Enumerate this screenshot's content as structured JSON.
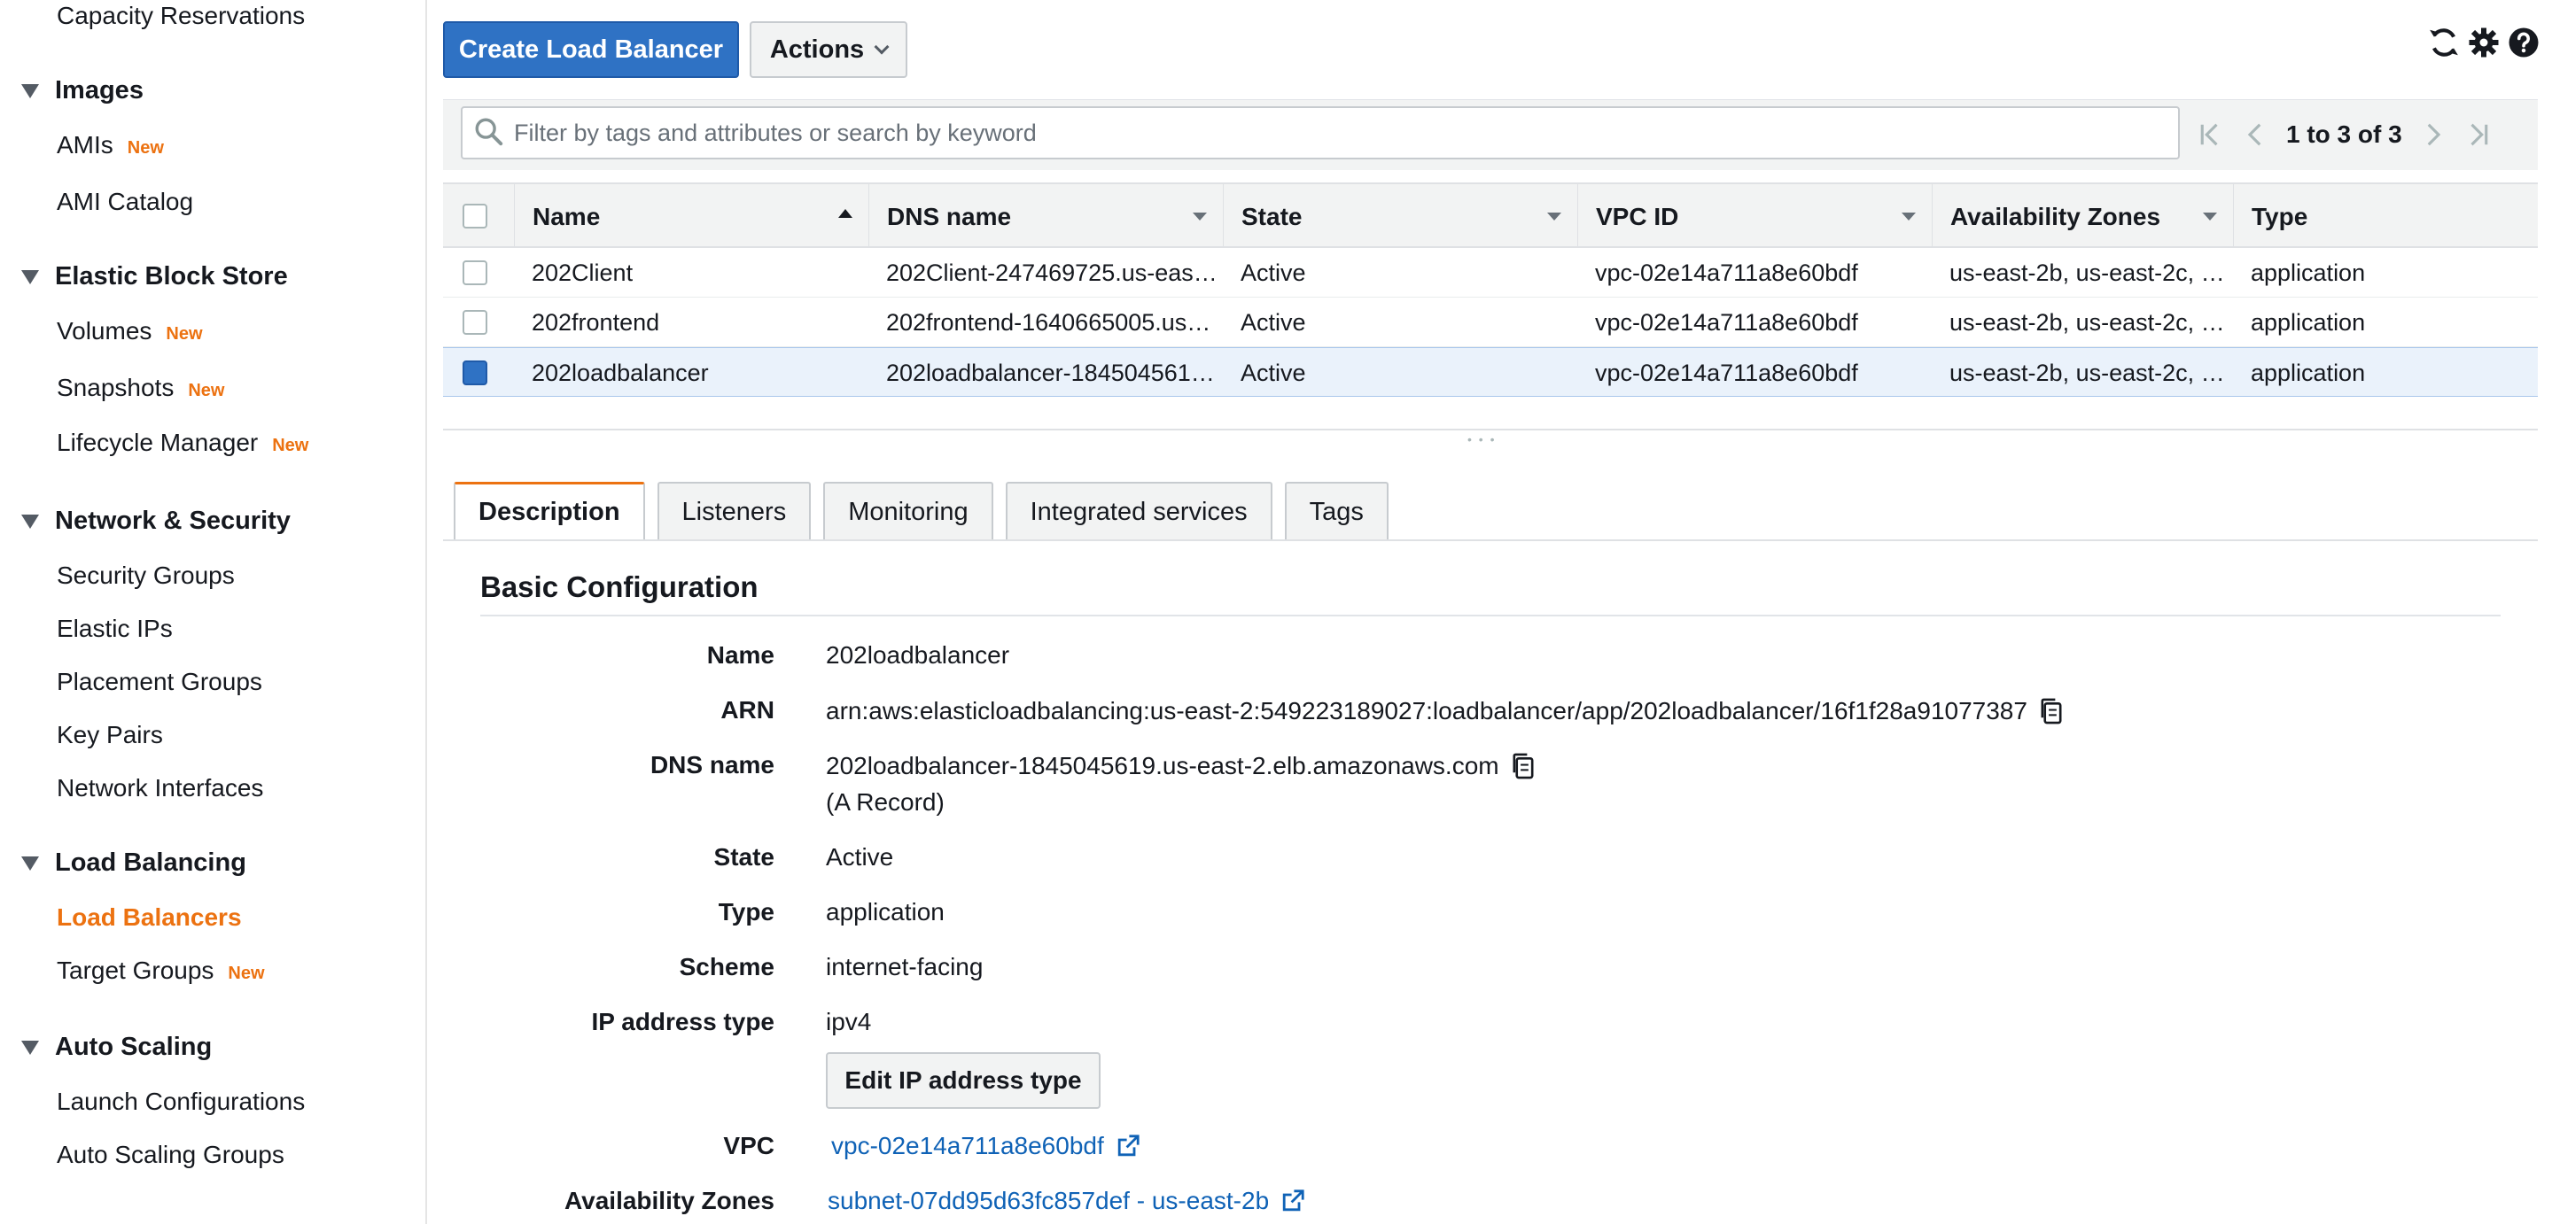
{
  "sidebar": {
    "capacity_reservations": "Capacity Reservations",
    "images": {
      "title": "Images",
      "amis": "AMIs",
      "amis_badge": "New",
      "ami_catalog": "AMI Catalog"
    },
    "ebs": {
      "title": "Elastic Block Store",
      "volumes": "Volumes",
      "volumes_badge": "New",
      "snapshots": "Snapshots",
      "snapshots_badge": "New",
      "lifecycle": "Lifecycle Manager",
      "lifecycle_badge": "New"
    },
    "network": {
      "title": "Network & Security",
      "security_groups": "Security Groups",
      "elastic_ips": "Elastic IPs",
      "placement_groups": "Placement Groups",
      "key_pairs": "Key Pairs",
      "network_interfaces": "Network Interfaces"
    },
    "load_balancing": {
      "title": "Load Balancing",
      "load_balancers": "Load Balancers",
      "target_groups": "Target Groups",
      "target_groups_badge": "New"
    },
    "auto_scaling": {
      "title": "Auto Scaling",
      "launch_configurations": "Launch Configurations",
      "auto_scaling_groups": "Auto Scaling Groups"
    }
  },
  "toolbar": {
    "create_label": "Create Load Balancer",
    "actions_label": "Actions"
  },
  "search": {
    "placeholder": "Filter by tags and attributes or search by keyword",
    "pager": "1 to 3 of 3"
  },
  "table": {
    "headers": {
      "name": "Name",
      "dns": "DNS name",
      "state": "State",
      "vpc": "VPC ID",
      "az": "Availability Zones",
      "type": "Type"
    },
    "rows": [
      {
        "name": "202Client",
        "dns": "202Client-247469725.us-eas…",
        "state": "Active",
        "vpc": "vpc-02e14a711a8e60bdf",
        "az": "us-east-2b, us-east-2c, …",
        "type": "application"
      },
      {
        "name": "202frontend",
        "dns": "202frontend-1640665005.us…",
        "state": "Active",
        "vpc": "vpc-02e14a711a8e60bdf",
        "az": "us-east-2b, us-east-2c, …",
        "type": "application"
      },
      {
        "name": "202loadbalancer",
        "dns": "202loadbalancer-184504561…",
        "state": "Active",
        "vpc": "vpc-02e14a711a8e60bdf",
        "az": "us-east-2b, us-east-2c, …",
        "type": "application"
      }
    ]
  },
  "tabs": {
    "description": "Description",
    "listeners": "Listeners",
    "monitoring": "Monitoring",
    "integrated": "Integrated services",
    "tags": "Tags"
  },
  "details": {
    "section_title": "Basic Configuration",
    "name_label": "Name",
    "name_value": "202loadbalancer",
    "arn_label": "ARN",
    "arn_value": "arn:aws:elasticloadbalancing:us-east-2:549223189027:loadbalancer/app/202loadbalancer/16f1f28a91077387",
    "dns_label": "DNS name",
    "dns_value": "202loadbalancer-1845045619.us-east-2.elb.amazonaws.com",
    "dns_note": "(A Record)",
    "state_label": "State",
    "state_value": "Active",
    "type_label": "Type",
    "type_value": "application",
    "scheme_label": "Scheme",
    "scheme_value": "internet-facing",
    "ip_label": "IP address type",
    "ip_value": "ipv4",
    "edit_ip_label": "Edit IP address type",
    "vpc_label": "VPC",
    "vpc_value": "vpc-02e14a711a8e60bdf",
    "az_label": "Availability Zones",
    "az_value": "subnet-07dd95d63fc857def - us-east-2b"
  },
  "colors": {
    "primary_button": "#2f72c4",
    "active_nav": "#ec7211",
    "link": "#0f62b6"
  }
}
